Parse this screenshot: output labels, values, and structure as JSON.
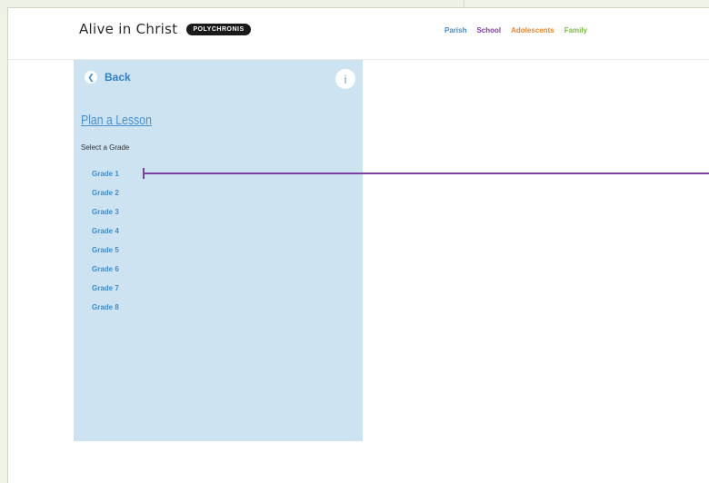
{
  "header": {
    "logo_text": "Alive in Christ",
    "logo_badge": "POLYCHRONIS",
    "nav": [
      {
        "label": "Parish",
        "color": "#3d8dcf"
      },
      {
        "label": "School",
        "color": "#7b3c9b"
      },
      {
        "label": "Adolescents",
        "color": "#e8862e"
      },
      {
        "label": "Family",
        "color": "#7dbb46"
      }
    ]
  },
  "panel": {
    "back_label": "Back",
    "info_label": "i",
    "title": "Plan a Lesson",
    "select_label": "Select a Grade",
    "grades": [
      "Grade 1",
      "Grade 2",
      "Grade 3",
      "Grade 4",
      "Grade 5",
      "Grade 6",
      "Grade 7",
      "Grade 8"
    ],
    "background": "#cde3f2"
  },
  "annotation": {
    "color": "#7c3fa2"
  }
}
